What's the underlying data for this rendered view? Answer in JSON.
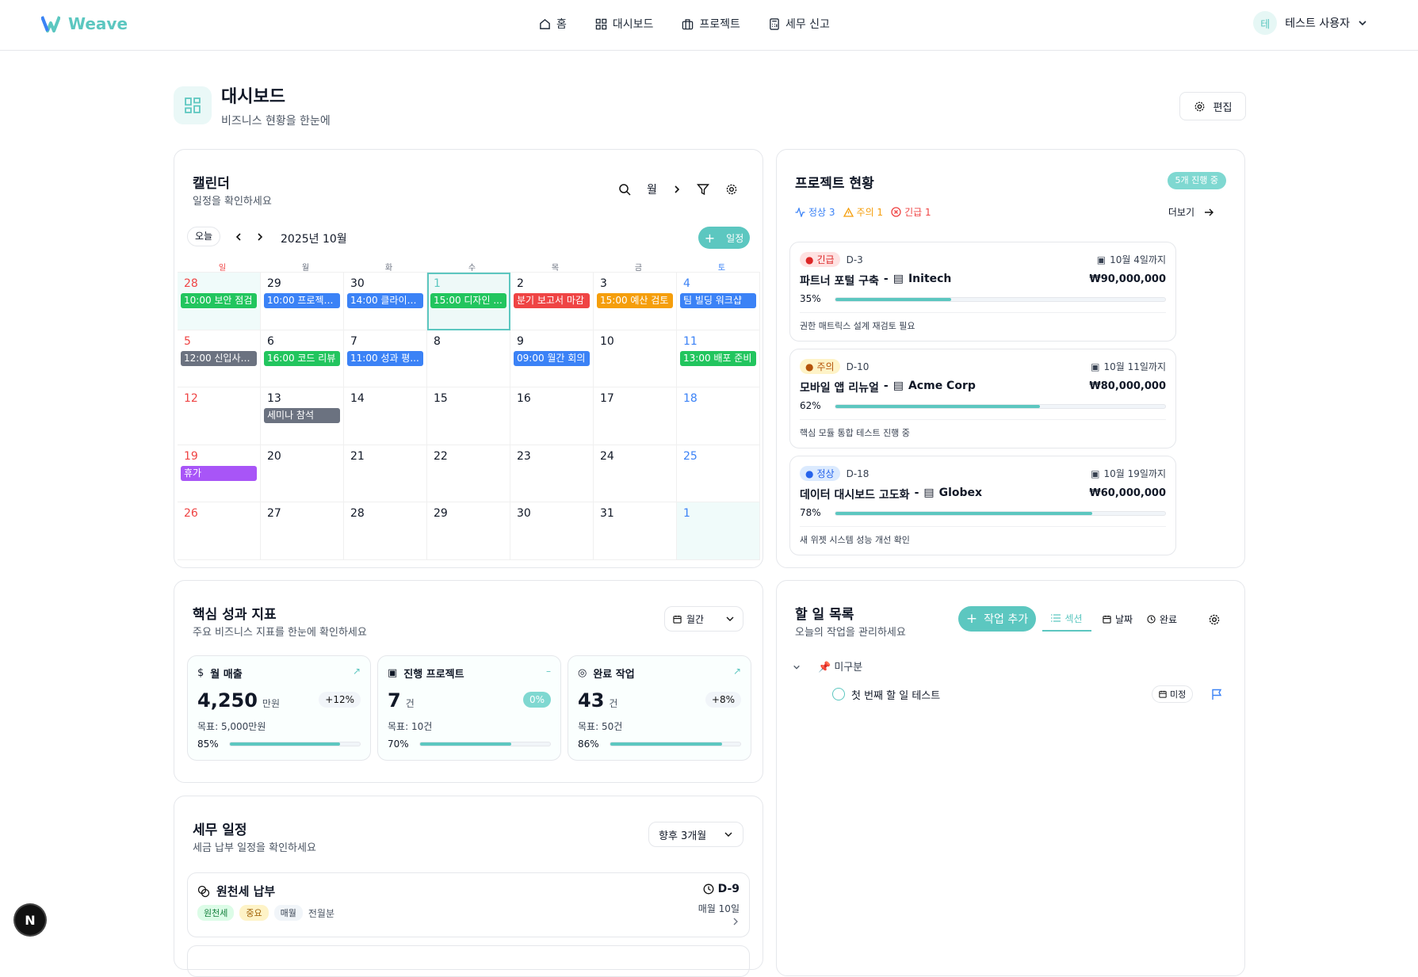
{
  "app": {
    "name": "Weave"
  },
  "nav": [
    {
      "label": "홈",
      "icon": "home-icon"
    },
    {
      "label": "대시보드",
      "icon": "grid-icon"
    },
    {
      "label": "프로젝트",
      "icon": "briefcase-icon"
    },
    {
      "label": "세무 신고",
      "icon": "calculator-icon"
    }
  ],
  "user": {
    "avatar": "테",
    "name": "테스트 사용자"
  },
  "page": {
    "title": "대시보드",
    "subtitle": "비즈니스 현황을 한눈에",
    "edit_label": "편집"
  },
  "calendar": {
    "title": "캘린더",
    "subtitle": "일정을 확인하세요",
    "view": "월",
    "today": "오늘",
    "month": "2025년 10월",
    "add": "일정",
    "weekdays": [
      "일",
      "월",
      "화",
      "수",
      "목",
      "금",
      "토"
    ],
    "weeks": [
      [
        {
          "d": "28",
          "ev": {
            "t": "10:00 보안 점검",
            "c": "#22c55e"
          },
          "bg": true
        },
        {
          "d": "29",
          "ev": {
            "t": "10:00 프로젝트...",
            "c": "#3b82f6"
          }
        },
        {
          "d": "30",
          "ev": {
            "t": "14:00 클라이언...",
            "c": "#3b82f6"
          }
        },
        {
          "d": "1",
          "ev": {
            "t": "15:00 디자인 ...",
            "c": "#22c55e"
          },
          "today": true
        },
        {
          "d": "2",
          "ev": {
            "t": "분기 보고서 마감",
            "c": "#ef4444"
          }
        },
        {
          "d": "3",
          "ev": {
            "t": "15:00 예산 검토",
            "c": "#f59e0b"
          }
        },
        {
          "d": "4",
          "ev": {
            "t": "팀 빌딩 워크샵",
            "c": "#3b82f6"
          }
        }
      ],
      [
        {
          "d": "5",
          "ev": {
            "t": "12:00 신입사원...",
            "c": "#6b7280"
          }
        },
        {
          "d": "6",
          "ev": {
            "t": "16:00 코드 리뷰",
            "c": "#22c55e"
          }
        },
        {
          "d": "7",
          "ev": {
            "t": "11:00 성과 평...",
            "c": "#3b82f6"
          }
        },
        {
          "d": "8"
        },
        {
          "d": "9",
          "ev": {
            "t": "09:00 월간 회의",
            "c": "#3b82f6"
          }
        },
        {
          "d": "10"
        },
        {
          "d": "11",
          "ev": {
            "t": "13:00 배포 준비",
            "c": "#22c55e"
          }
        }
      ],
      [
        {
          "d": "12"
        },
        {
          "d": "13",
          "ev": {
            "t": "세미나 참석",
            "c": "#6b7280"
          }
        },
        {
          "d": "14"
        },
        {
          "d": "15"
        },
        {
          "d": "16"
        },
        {
          "d": "17"
        },
        {
          "d": "18"
        }
      ],
      [
        {
          "d": "19",
          "ev": {
            "t": "휴가",
            "c": "#a855f7"
          }
        },
        {
          "d": "20"
        },
        {
          "d": "21"
        },
        {
          "d": "22"
        },
        {
          "d": "23"
        },
        {
          "d": "24"
        },
        {
          "d": "25"
        }
      ],
      [
        {
          "d": "26"
        },
        {
          "d": "27"
        },
        {
          "d": "28"
        },
        {
          "d": "29"
        },
        {
          "d": "30"
        },
        {
          "d": "31"
        },
        {
          "d": "1",
          "bg": true
        }
      ]
    ]
  },
  "projects": {
    "title": "프로젝트 현황",
    "badge": "5개 진행 중",
    "normal": "정상 3",
    "warn": "주의 1",
    "urgent": "긴급 1",
    "more": "더보기",
    "items": [
      {
        "status": "긴급",
        "dday": "D-3",
        "due": "10월 4일까지",
        "name": "파트너 포털 구축",
        "client": "Initech",
        "amount": "₩90,000,000",
        "pct": "35%",
        "progress": 0.35,
        "note": "권한 매트릭스 설계 재검토 필요",
        "kind": "urgent"
      },
      {
        "status": "주의",
        "dday": "D-10",
        "due": "10월 11일까지",
        "name": "모바일 앱 리뉴얼",
        "client": "Acme Corp",
        "amount": "₩80,000,000",
        "pct": "62%",
        "progress": 0.62,
        "note": "핵심 모듈 통합 테스트 진행 중",
        "kind": "warn"
      },
      {
        "status": "정상",
        "dday": "D-18",
        "due": "10월 19일까지",
        "name": "데이터 대시보드 고도화",
        "client": "Globex",
        "amount": "₩60,000,000",
        "pct": "78%",
        "progress": 0.78,
        "note": "새 위젯 시스템 성능 개선 확인",
        "kind": "normal"
      }
    ]
  },
  "kpi": {
    "title": "핵심 성과 지표",
    "subtitle": "주요 비즈니스 지표를 한눈에 확인하세요",
    "period": "월간",
    "items": [
      {
        "label": "월 매출",
        "icon": "dollar-icon",
        "value": "4,250",
        "unit": "만원",
        "delta": "+12%",
        "target": "목표: 5,000만원",
        "pct": "85%",
        "progress": 0.85
      },
      {
        "label": "진행 프로젝트",
        "icon": "briefcase-icon",
        "value": "7",
        "unit": "건",
        "delta": "0%",
        "target": "목표: 10건",
        "pct": "70%",
        "progress": 0.7
      },
      {
        "label": "완료 작업",
        "icon": "check-circle-icon",
        "value": "43",
        "unit": "건",
        "delta": "+8%",
        "target": "목표: 50건",
        "pct": "86%",
        "progress": 0.86
      }
    ]
  },
  "tax": {
    "title": "세무 일정",
    "subtitle": "세금 납부 일정을 확인하세요",
    "range": "향후 3개월",
    "item": {
      "name": "원천세 납부",
      "tags": [
        "원천세",
        "중요",
        "매월"
      ],
      "extra": "전월분",
      "dday": "D-9",
      "date": "매월 10일"
    }
  },
  "todo": {
    "title": "할 일 목록",
    "subtitle": "오늘의 작업을 관리하세요",
    "add": "작업 추가",
    "tabs": [
      "섹션",
      "날짜",
      "완료"
    ],
    "section": "📌 미구분",
    "task": "첫 번째 할 일 테스트",
    "task_badge": "미정"
  },
  "fab": "N"
}
